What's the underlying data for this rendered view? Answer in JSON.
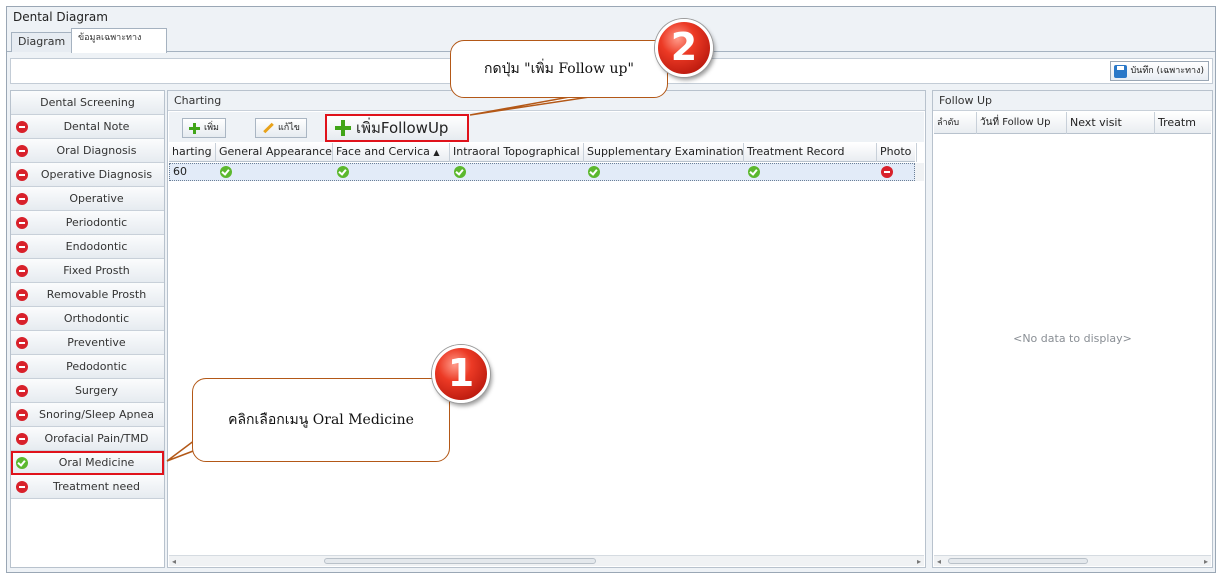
{
  "window": {
    "title": "Dental Diagram"
  },
  "tabs": [
    {
      "label": "Diagram",
      "active": false
    },
    {
      "label": "ข้อมูลเฉพาะทาง",
      "active": true
    }
  ],
  "toolbar": {
    "save_label": "บันทึก (เฉพาะทาง)",
    "save_icon": "save-disk-icon"
  },
  "sidebar": {
    "header": "Dental Screening",
    "items": [
      {
        "label": "Dental Note",
        "status": "red"
      },
      {
        "label": "Oral Diagnosis",
        "status": "red"
      },
      {
        "label": "Operative Diagnosis",
        "status": "red"
      },
      {
        "label": "Operative",
        "status": "red"
      },
      {
        "label": "Periodontic",
        "status": "red"
      },
      {
        "label": "Endodontic",
        "status": "red"
      },
      {
        "label": "Fixed Prosth",
        "status": "red"
      },
      {
        "label": "Removable Prosth",
        "status": "red"
      },
      {
        "label": "Orthodontic",
        "status": "red"
      },
      {
        "label": "Preventive",
        "status": "red"
      },
      {
        "label": "Pedodontic",
        "status": "red"
      },
      {
        "label": "Surgery",
        "status": "red"
      },
      {
        "label": "Snoring/Sleep Apnea",
        "status": "red"
      },
      {
        "label": "Orofacial Pain/TMD",
        "status": "red"
      },
      {
        "label": "Oral Medicine",
        "status": "green",
        "selected": true
      },
      {
        "label": "Treatment need",
        "status": "red"
      }
    ]
  },
  "charting": {
    "title": "Charting",
    "buttons": {
      "add": "เพิ่ม",
      "edit": "แก้ไข",
      "add_followup": "เพิ่มFollowUp"
    },
    "columns": [
      "harting",
      "General Appearance",
      "Face and Cervica",
      "Intraoral Topographical",
      "Supplementary Examination",
      "Treatment Record",
      "Photo"
    ],
    "sort_indicator": "▲",
    "rows": [
      {
        "charting": "60",
        "statuses": [
          "green",
          "green",
          "green",
          "green",
          "green",
          "red"
        ]
      }
    ]
  },
  "followup": {
    "title": "Follow Up",
    "columns": [
      "ลำดับ",
      "วันที่ Follow Up",
      "Next visit",
      "Treatm"
    ],
    "empty_text": "<No data to display>"
  },
  "callouts": {
    "step1": {
      "number": "1",
      "text": "คลิกเลือกเมนู Oral Medicine"
    },
    "step2": {
      "number": "2",
      "text": "กดปุ่ม \"เพิ่ม Follow up\""
    }
  },
  "colors": {
    "highlight": "#e0121b",
    "status_red": "#d8212b",
    "status_green": "#5cb82e",
    "badge": "#ec3a25",
    "callout_border": "#b35817"
  }
}
